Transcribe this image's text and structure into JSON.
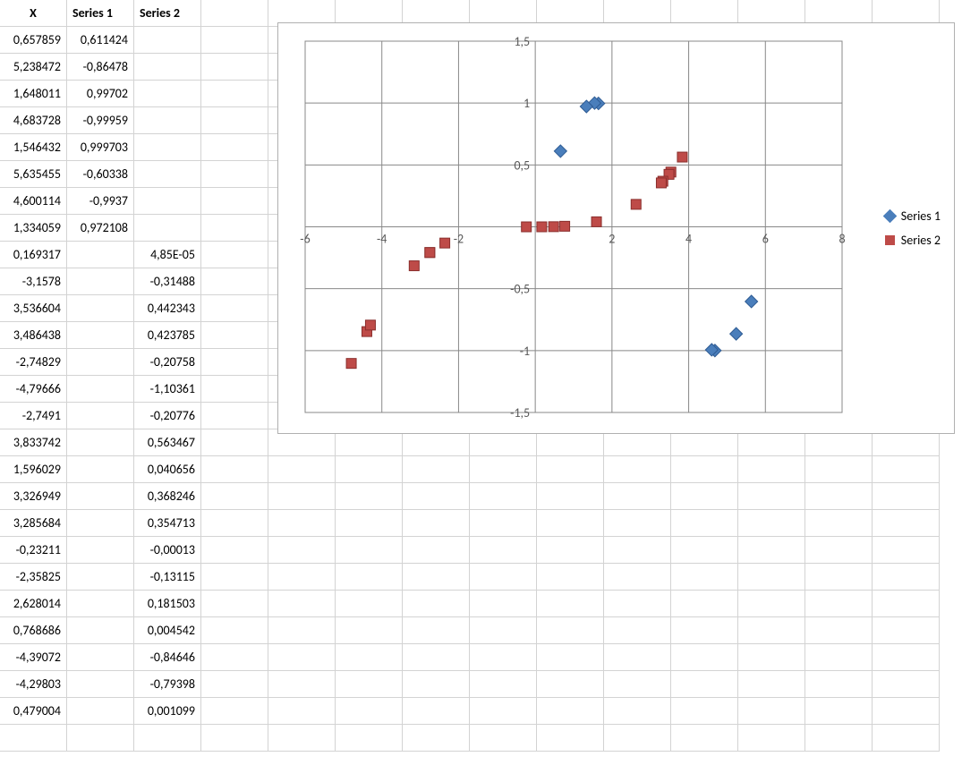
{
  "headers": {
    "x": "X",
    "s1": "Series 1",
    "s2": "Series 2"
  },
  "rows": [
    {
      "x": "0,657859",
      "s1": "0,611424",
      "s2": ""
    },
    {
      "x": "5,238472",
      "s1": "-0,86478",
      "s2": ""
    },
    {
      "x": "1,648011",
      "s1": "0,99702",
      "s2": ""
    },
    {
      "x": "4,683728",
      "s1": "-0,99959",
      "s2": ""
    },
    {
      "x": "1,546432",
      "s1": "0,999703",
      "s2": ""
    },
    {
      "x": "5,635455",
      "s1": "-0,60338",
      "s2": ""
    },
    {
      "x": "4,600114",
      "s1": "-0,9937",
      "s2": ""
    },
    {
      "x": "1,334059",
      "s1": "0,972108",
      "s2": ""
    },
    {
      "x": "0,169317",
      "s1": "",
      "s2": "4,85E-05"
    },
    {
      "x": "-3,1578",
      "s1": "",
      "s2": "-0,31488"
    },
    {
      "x": "3,536604",
      "s1": "",
      "s2": "0,442343"
    },
    {
      "x": "3,486438",
      "s1": "",
      "s2": "0,423785"
    },
    {
      "x": "-2,74829",
      "s1": "",
      "s2": "-0,20758"
    },
    {
      "x": "-4,79666",
      "s1": "",
      "s2": "-1,10361"
    },
    {
      "x": "-2,7491",
      "s1": "",
      "s2": "-0,20776"
    },
    {
      "x": "3,833742",
      "s1": "",
      "s2": "0,563467"
    },
    {
      "x": "1,596029",
      "s1": "",
      "s2": "0,040656"
    },
    {
      "x": "3,326949",
      "s1": "",
      "s2": "0,368246"
    },
    {
      "x": "3,285684",
      "s1": "",
      "s2": "0,354713"
    },
    {
      "x": "-0,23211",
      "s1": "",
      "s2": "-0,00013"
    },
    {
      "x": "-2,35825",
      "s1": "",
      "s2": "-0,13115"
    },
    {
      "x": "2,628014",
      "s1": "",
      "s2": "0,181503"
    },
    {
      "x": "0,768686",
      "s1": "",
      "s2": "0,004542"
    },
    {
      "x": "-4,39072",
      "s1": "",
      "s2": "-0,84646"
    },
    {
      "x": "-4,29803",
      "s1": "",
      "s2": "-0,79398"
    },
    {
      "x": "0,479004",
      "s1": "",
      "s2": "0,001099"
    }
  ],
  "legend": {
    "s1": "Series 1",
    "s2": "Series 2"
  },
  "axis": {
    "xticks": [
      "-6",
      "-4",
      "-2",
      "0",
      "2",
      "4",
      "6",
      "8"
    ],
    "yticks": [
      "-1,5",
      "-1",
      "-0,5",
      "0",
      "0,5",
      "1",
      "1,5"
    ]
  },
  "chart_data": {
    "type": "scatter",
    "title": "",
    "xlabel": "",
    "ylabel": "",
    "xlim": [
      -6,
      8
    ],
    "ylim": [
      -1.5,
      1.5
    ],
    "xticks": [
      -6,
      -4,
      -2,
      0,
      2,
      4,
      6,
      8
    ],
    "yticks": [
      -1.5,
      -1,
      -0.5,
      0,
      0.5,
      1,
      1.5
    ],
    "grid": true,
    "legend_position": "right",
    "series": [
      {
        "name": "Series 1",
        "marker": "diamond",
        "color": "#4a7ebb",
        "points": [
          {
            "x": 0.657859,
            "y": 0.611424
          },
          {
            "x": 5.238472,
            "y": -0.86478
          },
          {
            "x": 1.648011,
            "y": 0.99702
          },
          {
            "x": 4.683728,
            "y": -0.99959
          },
          {
            "x": 1.546432,
            "y": 0.999703
          },
          {
            "x": 5.635455,
            "y": -0.60338
          },
          {
            "x": 4.600114,
            "y": -0.9937
          },
          {
            "x": 1.334059,
            "y": 0.972108
          }
        ]
      },
      {
        "name": "Series 2",
        "marker": "square",
        "color": "#be4b48",
        "points": [
          {
            "x": 0.169317,
            "y": 4.85e-05
          },
          {
            "x": -3.1578,
            "y": -0.31488
          },
          {
            "x": 3.536604,
            "y": 0.442343
          },
          {
            "x": 3.486438,
            "y": 0.423785
          },
          {
            "x": -2.74829,
            "y": -0.20758
          },
          {
            "x": -4.79666,
            "y": -1.10361
          },
          {
            "x": -2.7491,
            "y": -0.20776
          },
          {
            "x": 3.833742,
            "y": 0.563467
          },
          {
            "x": 1.596029,
            "y": 0.040656
          },
          {
            "x": 3.326949,
            "y": 0.368246
          },
          {
            "x": 3.285684,
            "y": 0.354713
          },
          {
            "x": -0.23211,
            "y": -0.00013
          },
          {
            "x": -2.35825,
            "y": -0.13115
          },
          {
            "x": 2.628014,
            "y": 0.181503
          },
          {
            "x": 0.768686,
            "y": 0.004542
          },
          {
            "x": -4.39072,
            "y": -0.84646
          },
          {
            "x": -4.29803,
            "y": -0.79398
          },
          {
            "x": 0.479004,
            "y": 0.001099
          }
        ]
      }
    ]
  }
}
